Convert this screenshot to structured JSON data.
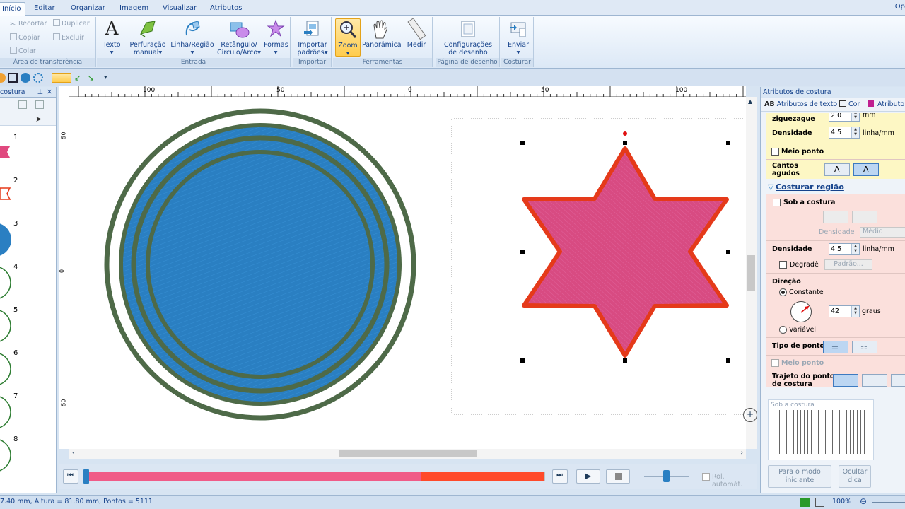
{
  "tabs": [
    "Início",
    "Editar",
    "Organizar",
    "Imagem",
    "Visualizar",
    "Atributos"
  ],
  "tab_right": "Op",
  "clipboard": {
    "cut": "Recortar",
    "duplicate": "Duplicar",
    "copy": "Copiar",
    "delete": "Excluir",
    "paste": "Colar",
    "group": "Área de transferência"
  },
  "entrada": {
    "text": "Texto",
    "manual_l1": "Perfuração",
    "manual_l2": "manual",
    "line_l1": "Linha/Região",
    "rect_l1": "Retângulo/",
    "rect_l2": "Círculo/Arco",
    "shapes": "Formas",
    "group": "Entrada"
  },
  "importar": {
    "btn_l1": "Importar",
    "btn_l2": "padrões",
    "group": "Importar"
  },
  "ferramentas": {
    "zoom": "Zoom",
    "pan": "Panorâmica",
    "measure": "Medir",
    "group": "Ferramentas"
  },
  "pagina": {
    "btn_l1": "Configurações",
    "btn_l2": "de desenho",
    "group": "Página de desenho"
  },
  "costurar": {
    "send": "Enviar",
    "group": "Costurar"
  },
  "left_panel": {
    "title": "costura",
    "items": [
      "1",
      "2",
      "3",
      "4",
      "5",
      "6",
      "7",
      "8"
    ]
  },
  "ruler": {
    "top": [
      "100",
      "50",
      "0",
      "50",
      "100"
    ],
    "left": [
      "50",
      "0",
      "50"
    ]
  },
  "playback": {
    "auto": "Rol. automát."
  },
  "right_panel": {
    "title": "Atributos de costura",
    "tab_text": "Atributos de texto",
    "tab_color": "Cor",
    "tab_attr": "Atributo",
    "zigzag": "ziguezague",
    "zigzag_value": "2.0",
    "zigzag_unit": "mm",
    "density_label": "Densidade",
    "density_value": "4.5",
    "density_unit": "linha/mm",
    "half_stitch": "Meio ponto",
    "corners_l1": "Cantos",
    "corners_l2": "agudos",
    "section_region": "Costurar região",
    "under_stitch": "Sob a costura",
    "under_density": "Densidade",
    "under_density_value": "Médio",
    "region_density": "Densidade",
    "region_density_value": "4.5",
    "region_density_unit": "linha/mm",
    "gradient": "Degradê",
    "pattern_btn": "Padrão...",
    "direction": "Direção",
    "constant": "Constante",
    "angle_value": "42",
    "angle_unit": "graus",
    "variable": "Variável",
    "stitch_type": "Tipo de ponto",
    "half_stitch2": "Meio ponto",
    "path_l1": "Trajeto do ponto",
    "path_l2": "de costura",
    "preview_label": "Sob a costura",
    "btn_beginner_l1": "Para o modo",
    "btn_beginner_l2": "iniciante",
    "btn_hide_l1": "Ocultar",
    "btn_hide_l2": "dica"
  },
  "status": {
    "dims": "7.40 mm, Altura = 81.80 mm, Pontos = 5111",
    "zoom": "100%"
  },
  "colors": {
    "circle_fill": "#2a7fc2",
    "circle_ring": "#4e6a48",
    "star_fill": "#d84b82",
    "star_outline": "#e53a1a",
    "accent": "#3d7ac0"
  }
}
